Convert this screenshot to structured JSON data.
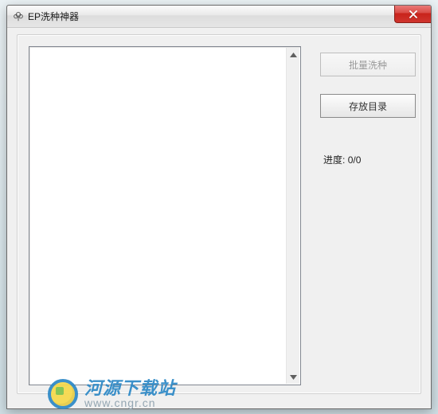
{
  "window": {
    "title": "EP洗种神器",
    "icon": "tree-icon"
  },
  "controls": {
    "close_symbol": "×"
  },
  "main": {
    "listbox_value": ""
  },
  "buttons": {
    "batch_label": "批量洗种",
    "batch_disabled": true,
    "dir_label": "存放目录"
  },
  "progress": {
    "label_prefix": "进度:",
    "value": "0/0"
  },
  "watermark": {
    "site_name": "河源下载站",
    "site_url": "www.cngr.cn"
  }
}
